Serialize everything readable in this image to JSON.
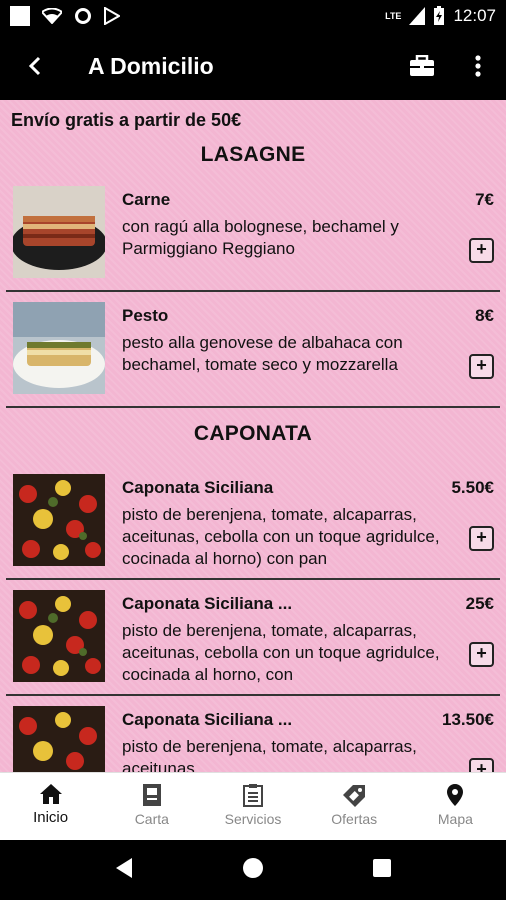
{
  "status_bar": {
    "time": "12:07",
    "network": "LTE"
  },
  "app_bar": {
    "title": "A Domicilio"
  },
  "notice": "Envío gratis a partir de 50€",
  "sections": [
    {
      "title": "LASAGNE",
      "items": [
        {
          "name": "Carne",
          "price": "7€",
          "description": "con ragú alla bolognese, bechamel y Parmiggiano Reggiano",
          "add": "+"
        },
        {
          "name": "Pesto",
          "price": "8€",
          "description": "pesto alla genovese de albahaca con bechamel, tomate seco y mozzarella",
          "add": "+"
        }
      ]
    },
    {
      "title": "CAPONATA",
      "items": [
        {
          "name": "Caponata Siciliana",
          "price": "5.50€",
          "description": "pisto de berenjena, tomate, alcaparras, aceitunas, cebolla con un toque agridulce, cocinada al horno) con pan",
          "add": "+"
        },
        {
          "name": "Caponata Siciliana ...",
          "price": "25€",
          "description": "pisto de berenjena, tomate, alcaparras, aceitunas, cebolla con un toque agridulce, cocinada al horno, con",
          "add": "+"
        },
        {
          "name": "Caponata Siciliana ...",
          "price": "13.50€",
          "description": "pisto de berenjena, tomate, alcaparras, aceitunas",
          "add": "+"
        }
      ]
    }
  ],
  "bottom_nav": [
    {
      "label": "Inicio",
      "icon": "home-icon"
    },
    {
      "label": "Carta",
      "icon": "menu-book-icon"
    },
    {
      "label": "Servicios",
      "icon": "clipboard-icon"
    },
    {
      "label": "Ofertas",
      "icon": "tag-icon"
    },
    {
      "label": "Mapa",
      "icon": "map-pin-icon"
    }
  ],
  "colors": {
    "background": "#f3b6d2",
    "bar": "#000000",
    "active_nav": "#111111",
    "inactive_nav": "#888888"
  }
}
